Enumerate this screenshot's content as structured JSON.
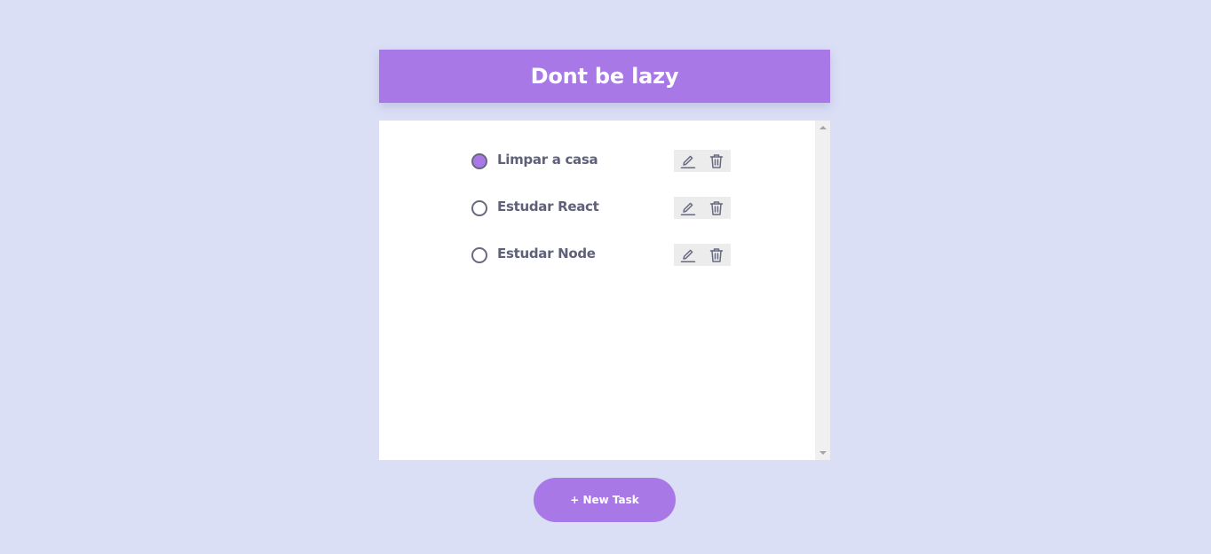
{
  "app": {
    "title": "Dont be lazy"
  },
  "tasks": [
    {
      "label": "Limpar a casa",
      "done": true
    },
    {
      "label": "Estudar React",
      "done": false
    },
    {
      "label": "Estudar Node",
      "done": false
    }
  ],
  "task_actions": {
    "edit_icon": "pencil-icon",
    "delete_icon": "trash-icon"
  },
  "footer": {
    "new_task_label": "+ New Task"
  },
  "colors": {
    "background": "#dadff5",
    "accent": "#a879e6",
    "text": "#5f617a",
    "icon": "#676981",
    "action_bg": "#ececec"
  }
}
